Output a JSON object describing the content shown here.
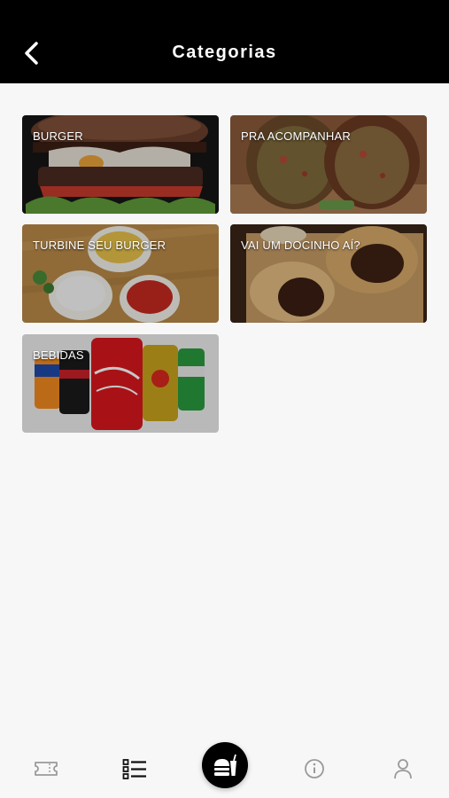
{
  "header": {
    "title": "Categorias",
    "back_icon": "chevron-left-icon"
  },
  "categories": [
    {
      "label": "BURGER"
    },
    {
      "label": "PRA ACOMPANHAR"
    },
    {
      "label": "TURBINE SEU BURGER"
    },
    {
      "label": "VAI UM DOCINHO AÍ?"
    },
    {
      "label": "BEBIDAS"
    }
  ],
  "bottom_nav": {
    "items": [
      "ticket-icon",
      "list-icon",
      "burger-drink-icon",
      "info-icon",
      "user-icon"
    ],
    "active_index": 1
  },
  "colors": {
    "header_bg": "#000000",
    "page_bg": "#f7f7f7",
    "icon_inactive": "#9a9a9a",
    "icon_active": "#111111"
  }
}
